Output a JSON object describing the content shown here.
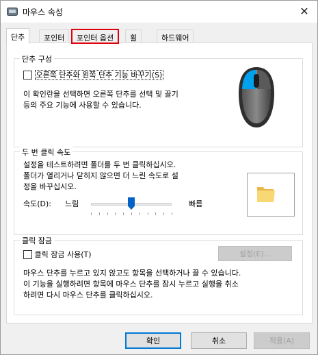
{
  "window": {
    "title": "마우스 속성",
    "close_glyph": "✕"
  },
  "tabs": [
    {
      "label": "단추",
      "active": true
    },
    {
      "label": "포인터",
      "active": false
    },
    {
      "label": "포인터 옵션",
      "active": false,
      "highlighted": true
    },
    {
      "label": "휠",
      "active": false
    },
    {
      "label": "하드웨어",
      "active": false
    }
  ],
  "button_config": {
    "title": "단추 구성",
    "swap_checkbox_label": "오른쪽 단추와 왼쪽 단추 기능 바꾸기(S)",
    "swap_checked": false,
    "description_line1": "이 확인란을 선택하면 오른쪽 단추를 선택 및 끌기",
    "description_line2": "등의 주요 기능에 사용할 수 있습니다."
  },
  "double_click": {
    "title": "두 번 클릭 속도",
    "desc_line1": "설정을 테스트하려면 폴더를 두 번 클릭하십시오.",
    "desc_line2": "폴더가 열리거나 닫히지 않으면 더 느린 속도로 설",
    "desc_line3": "정을 바꾸십시오.",
    "speed_label": "속도(D):",
    "slow_label": "느림",
    "fast_label": "빠름",
    "speed_value_fraction": 0.5
  },
  "click_lock": {
    "title": "클릭 잠금",
    "checkbox_label": "클릭 잠금 사용(T)",
    "checked": false,
    "settings_button": "설정(E)...",
    "desc_line1": "마우스 단추를 누르고 있지 않고도 항목을 선택하거나 끌 수 있습니다.",
    "desc_line2": "이 기능을 실행하려면 항목에 마우스 단추를 잠시 누르고 실행을 취소",
    "desc_line3": "하려면 다시 마우스 단추를 클릭하십시오."
  },
  "footer": {
    "ok": "확인",
    "cancel": "취소",
    "apply": "적용(A)"
  },
  "colors": {
    "accent": "#0078d7",
    "highlight_box": "#e0000f",
    "mouse_body": "#3b3b3b",
    "mouse_button": "#00a2ed"
  }
}
